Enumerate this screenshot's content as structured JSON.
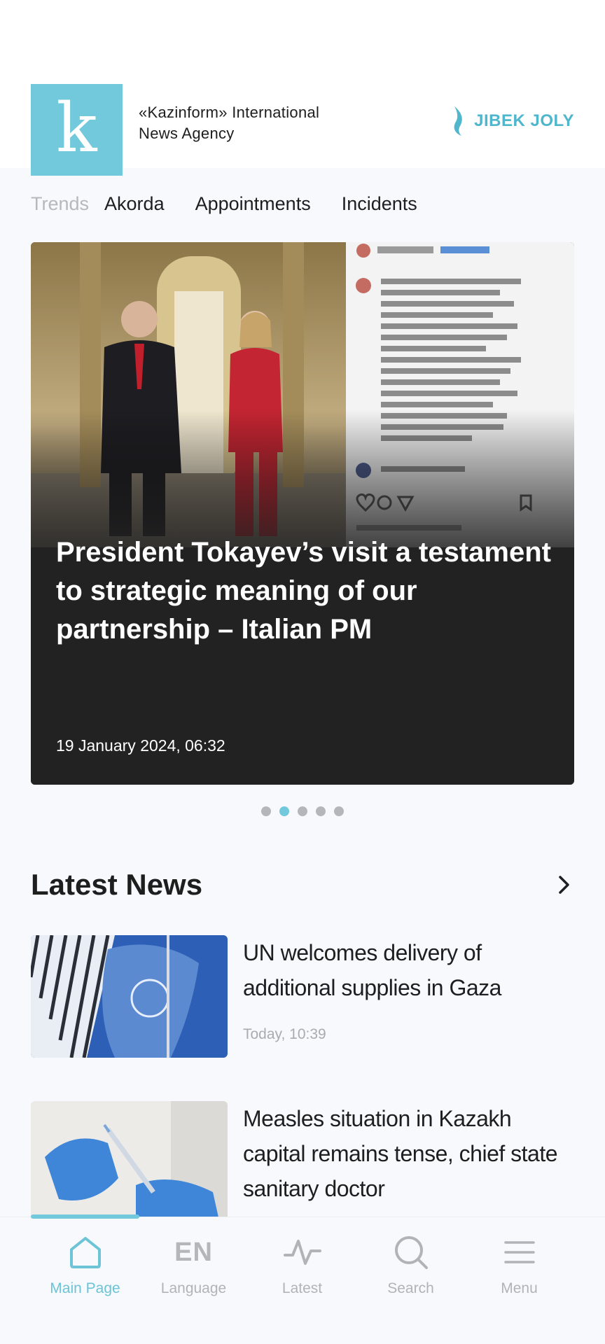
{
  "header": {
    "logo_letter": "k",
    "agency_name_line1": "«Kazinform» International",
    "agency_name_line2": "News Agency",
    "partner_name": "JIBEK JOLY",
    "accent_color": "#72c9db"
  },
  "trends": {
    "label": "Trends",
    "items": [
      "Akorda",
      "Appointments",
      "Incidents"
    ]
  },
  "hero": {
    "title": "President Tokayev’s visit a testament to strategic meaning of our partnership – Italian PM",
    "date": "19 January 2024, 06:32",
    "carousel_total": 5,
    "carousel_active_index": 1
  },
  "latest_news": {
    "title": "Latest News",
    "items": [
      {
        "title": "UN welcomes delivery of additional supplies in Gaza",
        "time": "Today, 10:39",
        "image": "un-flag-photo"
      },
      {
        "title": "Measles situation in Kazakh capital remains tense, chief state sanitary doctor",
        "time": "",
        "image": "vaccine-syringe-photo"
      }
    ]
  },
  "bottom_nav": {
    "items": [
      {
        "label": "Main Page",
        "icon": "home-icon",
        "active": true
      },
      {
        "label": "Language",
        "icon": "EN",
        "active": false
      },
      {
        "label": "Latest",
        "icon": "pulse-icon",
        "active": false
      },
      {
        "label": "Search",
        "icon": "search-icon",
        "active": false
      },
      {
        "label": "Menu",
        "icon": "menu-icon",
        "active": false
      }
    ]
  }
}
